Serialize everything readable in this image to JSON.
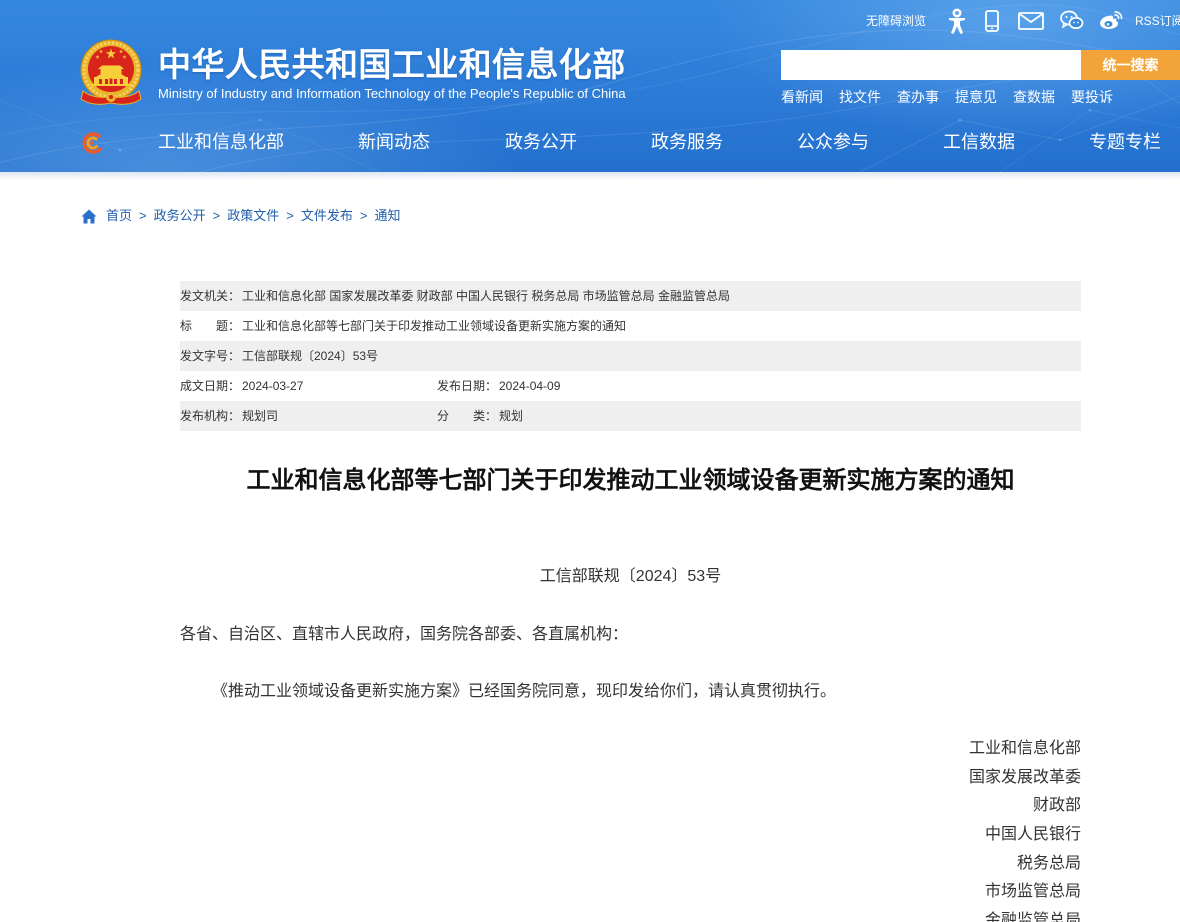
{
  "header": {
    "utility": {
      "accessibility_label": "无障碍浏览",
      "rss_label": "RSS订阅",
      "icons": [
        "accessibility-person-icon",
        "mobile-phone-icon",
        "mail-icon",
        "wechat-icon",
        "weibo-icon"
      ]
    },
    "logo": {
      "emblem_icon": "national-emblem-icon",
      "title_cn": "中华人民共和国工业和信息化部",
      "title_en": "Ministry of Industry and Information Technology of the People's Republic of China"
    },
    "search": {
      "value": "",
      "button_label": "统一搜索"
    },
    "quick_links": [
      "看新闻",
      "找文件",
      "查办事",
      "提意见",
      "查数据",
      "要投诉"
    ],
    "nav": {
      "logo_icon": "miit-swirl-logo-icon",
      "items": [
        "工业和信息化部",
        "新闻动态",
        "政务公开",
        "政务服务",
        "公众参与",
        "工信数据",
        "专题专栏"
      ]
    }
  },
  "breadcrumb": {
    "icon": "home-icon",
    "separator": ">",
    "items": [
      "首页",
      "政务公开",
      "政策文件",
      "文件发布",
      "通知"
    ]
  },
  "info_table": {
    "rows": [
      [
        {
          "label": "发文机关：",
          "value": "工业和信息化部 国家发展改革委 财政部 中国人民银行 税务总局 市场监管总局 金融监管总局"
        }
      ],
      [
        {
          "label": "标　　题：",
          "value": "工业和信息化部等七部门关于印发推动工业领域设备更新实施方案的通知"
        }
      ],
      [
        {
          "label": "发文字号：",
          "value": "工信部联规〔2024〕53号"
        }
      ],
      [
        {
          "label": "成文日期：",
          "value": "2024-03-27"
        },
        {
          "label": "发布日期：",
          "value": "2024-04-09"
        }
      ],
      [
        {
          "label": "发布机构：",
          "value": "规划司"
        },
        {
          "label": "分　　类：",
          "value": "规划"
        }
      ]
    ]
  },
  "article": {
    "title": "工业和信息化部等七部门关于印发推动工业领域设备更新实施方案的通知",
    "doc_number": "工信部联规〔2024〕53号",
    "salutation": "各省、自治区、直辖市人民政府，国务院各部委、各直属机构：",
    "paragraphs": [
      "《推动工业领域设备更新实施方案》已经国务院同意，现印发给你们，请认真贯彻执行。"
    ],
    "signatories": [
      "工业和信息化部",
      "国家发展改革委",
      "财政部",
      "中国人民银行",
      "税务总局",
      "市场监管总局",
      "金融监管总局"
    ]
  },
  "colors": {
    "header_blue": "#2c7bd7",
    "search_button_orange": "#f2a43a",
    "link_blue": "#1f5fae",
    "table_stripe_gray": "#efefef",
    "body_text": "#333333"
  }
}
